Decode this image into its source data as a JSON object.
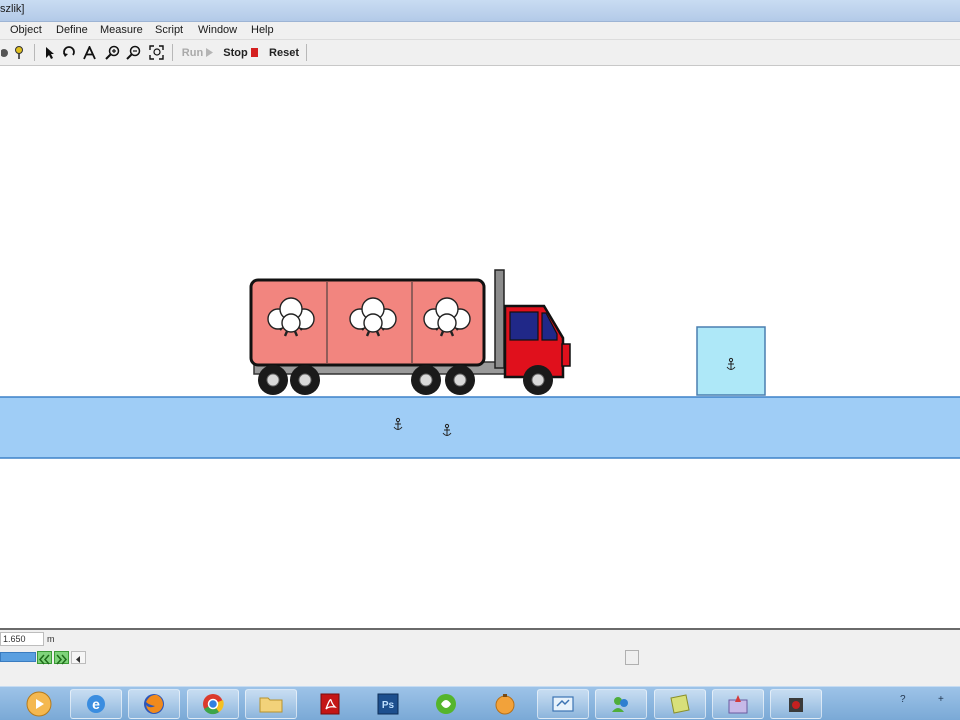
{
  "window": {
    "title": "szlik]"
  },
  "menu": {
    "items": [
      "Object",
      "Define",
      "Measure",
      "Script",
      "Window",
      "Help"
    ]
  },
  "toolbar": {
    "tools": [
      "point-icon",
      "tack-icon",
      "arrow-icon",
      "rotate-icon",
      "text-icon",
      "zoom-in-icon",
      "zoom-out-icon",
      "fit-icon"
    ],
    "run_label": "Run",
    "stop_label": "Stop",
    "reset_label": "Reset",
    "run_enabled": false
  },
  "scene": {
    "objects": [
      "truck",
      "box",
      "ground"
    ],
    "colors": {
      "truck_body": "#f2857f",
      "cab": "#e0101c",
      "box": "#aee8f8",
      "ground": "#9fcdf6",
      "window": "#202888"
    }
  },
  "status": {
    "coordinate": "1.650",
    "unit": "m"
  },
  "taskbar": {
    "apps": [
      "start-orb",
      "internet-explorer-icon",
      "firefox-icon",
      "chrome-icon",
      "folder-icon",
      "acrobat-icon",
      "photoshop-icon",
      "green-app-icon",
      "orange-app-icon",
      "network-icon",
      "messenger-icon",
      "notes-icon",
      "paint-icon",
      "camera-icon"
    ],
    "tray_items": [
      "?",
      "+"
    ]
  }
}
